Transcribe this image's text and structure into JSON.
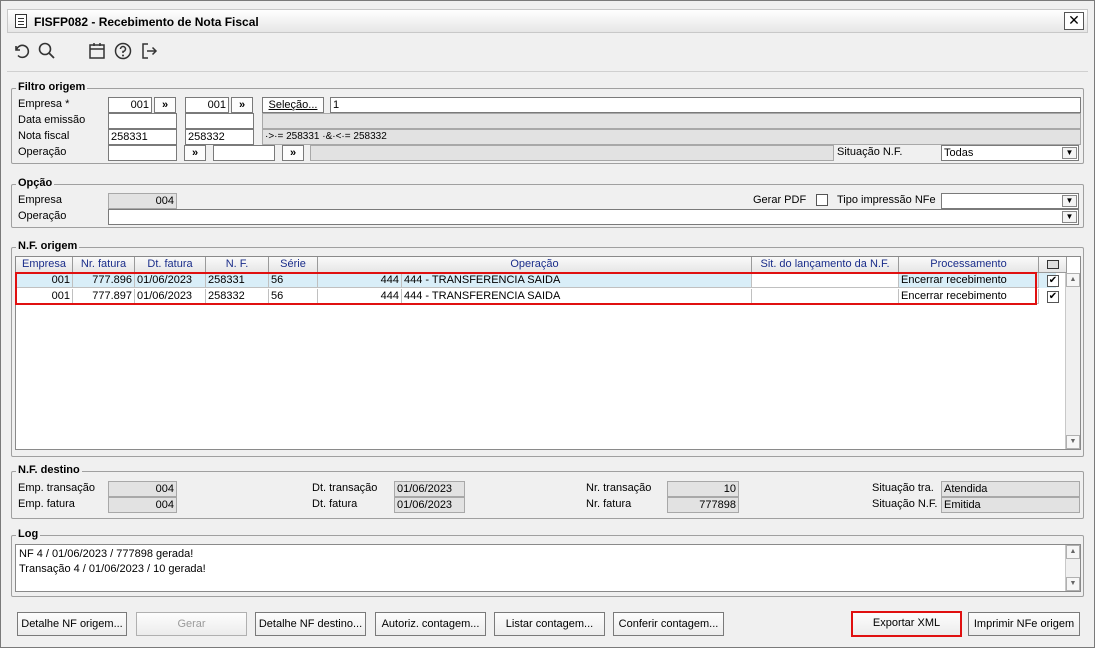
{
  "window": {
    "title": "FISFP082 - Recebimento de Nota Fiscal",
    "close_glyph": "✕"
  },
  "toolbar": {
    "icons": [
      "undo-icon",
      "search-icon",
      "calendar-icon",
      "help-icon",
      "exit-icon"
    ]
  },
  "filtro": {
    "title": "Filtro origem",
    "empresa_label": "Empresa *",
    "empresa_from": "001",
    "empresa_to": "001",
    "lookup_glyph": "»",
    "selecao_label": "Seleção...",
    "selecao_value": "1",
    "data_emissao_label": "Data emissão",
    "data_emissao_from": "",
    "data_emissao_to": "",
    "nota_fiscal_label": "Nota fiscal",
    "nota_fiscal_from": "258331",
    "nota_fiscal_to": "258332",
    "nota_fiscal_desc": "·>·= 258331 ·&·<·= 258332",
    "operacao_label": "Operação",
    "operacao_from": "",
    "operacao_to": "",
    "situacao_label": "Situação N.F.",
    "situacao_value": "Todas"
  },
  "opcao": {
    "title": "Opção",
    "empresa_label": "Empresa",
    "empresa_value": "004",
    "gerar_pdf_label": "Gerar PDF",
    "tipo_impressao_label": "Tipo impressão NFe",
    "tipo_impressao_value": "",
    "operacao_label": "Operação",
    "operacao_value": ""
  },
  "nf_origem": {
    "title": "N.F. origem",
    "columns": [
      "Empresa",
      "Nr. fatura",
      "Dt. fatura",
      "N. F.",
      "Série",
      "Operação",
      "Sit. do lançamento da N.F.",
      "Processamento"
    ],
    "rows": [
      {
        "empresa": "001",
        "nr_fatura": "777.896",
        "dt_fatura": "01/06/2023",
        "nf": "258331",
        "serie": "56",
        "op_code": "444",
        "op_desc": "444 - TRANSFERENCIA SAIDA",
        "sit": "",
        "proc": "Encerrar recebimento",
        "checked": "✔"
      },
      {
        "empresa": "001",
        "nr_fatura": "777.897",
        "dt_fatura": "01/06/2023",
        "nf": "258332",
        "serie": "56",
        "op_code": "444",
        "op_desc": "444 - TRANSFERENCIA SAIDA",
        "sit": "",
        "proc": "Encerrar recebimento",
        "checked": "✔"
      }
    ]
  },
  "nf_destino": {
    "title": "N.F. destino",
    "emp_transacao_label": "Emp. transação",
    "emp_transacao_value": "004",
    "emp_fatura_label": "Emp. fatura",
    "emp_fatura_value": "004",
    "dt_transacao_label": "Dt. transação",
    "dt_transacao_value": "01/06/2023",
    "dt_fatura_label": "Dt. fatura",
    "dt_fatura_value": "01/06/2023",
    "nr_transacao_label": "Nr. transação",
    "nr_transacao_value": "10",
    "nr_fatura_label": "Nr. fatura",
    "nr_fatura_value": "777898",
    "situacao_tra_label": "Situação tra.",
    "situacao_tra_value": "Atendida",
    "situacao_nf_label": "Situação N.F.",
    "situacao_nf_value": "Emitida"
  },
  "log": {
    "title": "Log",
    "lines": [
      "NF 4 / 01/06/2023 / 777898 gerada!",
      "Transação 4 / 01/06/2023 / 10 gerada!"
    ]
  },
  "buttons": {
    "detalhe_origem": "Detalhe NF origem...",
    "gerar": "Gerar",
    "detalhe_destino": "Detalhe NF destino...",
    "autoriz": "Autoriz. contagem...",
    "listar": "Listar contagem...",
    "conferir": "Conferir contagem...",
    "exportar": "Exportar XML",
    "imprimir": "Imprimir NFe origem"
  },
  "colors": {
    "header_text": "#1a2d8a",
    "highlight": "#e01010",
    "selected_row": "#d9eef8"
  }
}
